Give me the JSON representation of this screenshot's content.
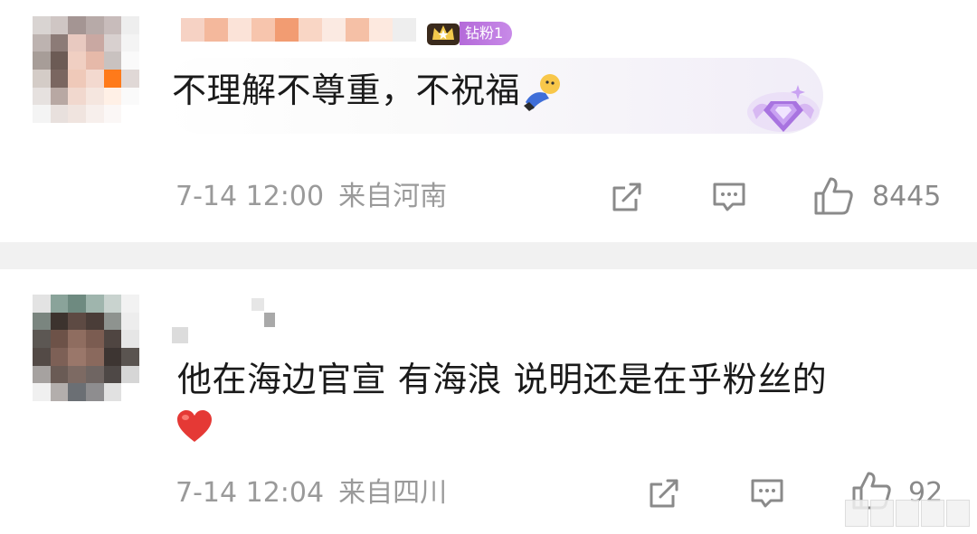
{
  "comments": [
    {
      "badge": "钻粉1",
      "text": "不理解不尊重，不祝福",
      "time": "7-14 12:00",
      "location": "来自河南",
      "likes": "8445"
    },
    {
      "text": "他在海边官宣 有海浪 说明还是在乎粉丝的",
      "time": "7-14 12:04",
      "location": "来自四川",
      "likes": "92"
    }
  ],
  "icons": {
    "share": "share-icon",
    "reply": "comment-icon",
    "like": "thumbs-up-icon",
    "emoji_1": "lying-down-emoji",
    "emoji_2": "heart-emoji",
    "crown": "crown-badge-icon",
    "diamond": "diamond-decoration-icon"
  },
  "colors": {
    "meta_gray": "#9a9a9a",
    "badge_purple": "#b46ad9",
    "heart_red": "#e53935",
    "separator": "#f1f1f1"
  }
}
